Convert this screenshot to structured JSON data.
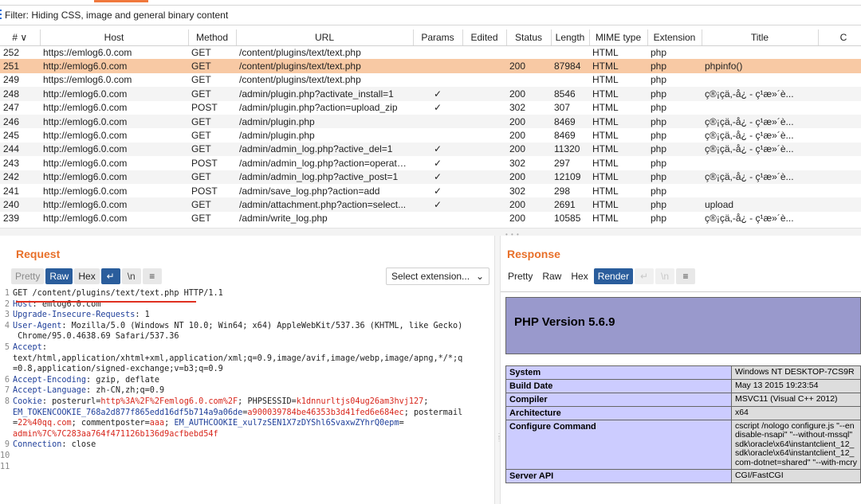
{
  "filter": {
    "text": "Filter: Hiding CSS, image and general binary content"
  },
  "table": {
    "headers": [
      "# ∨",
      "Host",
      "Method",
      "URL",
      "Params",
      "Edited",
      "Status",
      "Length",
      "MIME type",
      "Extension",
      "Title",
      "C"
    ],
    "rows": [
      {
        "num": "252",
        "host": "https://emlog6.0.com",
        "method": "GET",
        "url": "/content/plugins/text/text.php",
        "params": "",
        "edited": "",
        "status": "",
        "length": "",
        "mime": "HTML",
        "ext": "php",
        "title": ""
      },
      {
        "num": "251",
        "host": "http://emlog6.0.com",
        "method": "GET",
        "url": "/content/plugins/text/text.php",
        "params": "",
        "edited": "",
        "status": "200",
        "length": "87984",
        "mime": "HTML",
        "ext": "php",
        "title": "phpinfo()"
      },
      {
        "num": "249",
        "host": "https://emlog6.0.com",
        "method": "GET",
        "url": "/content/plugins/text/text.php",
        "params": "",
        "edited": "",
        "status": "",
        "length": "",
        "mime": "HTML",
        "ext": "php",
        "title": ""
      },
      {
        "num": "248",
        "host": "http://emlog6.0.com",
        "method": "GET",
        "url": "/admin/plugin.php?activate_install=1",
        "params": "✓",
        "edited": "",
        "status": "200",
        "length": "8546",
        "mime": "HTML",
        "ext": "php",
        "title": "ç®¡çä,-å¿ - ç¹æ»´è..."
      },
      {
        "num": "247",
        "host": "http://emlog6.0.com",
        "method": "POST",
        "url": "/admin/plugin.php?action=upload_zip",
        "params": "✓",
        "edited": "",
        "status": "302",
        "length": "307",
        "mime": "HTML",
        "ext": "php",
        "title": ""
      },
      {
        "num": "246",
        "host": "http://emlog6.0.com",
        "method": "GET",
        "url": "/admin/plugin.php",
        "params": "",
        "edited": "",
        "status": "200",
        "length": "8469",
        "mime": "HTML",
        "ext": "php",
        "title": "ç®¡çä,-å¿ - ç¹æ»´è..."
      },
      {
        "num": "245",
        "host": "http://emlog6.0.com",
        "method": "GET",
        "url": "/admin/plugin.php",
        "params": "",
        "edited": "",
        "status": "200",
        "length": "8469",
        "mime": "HTML",
        "ext": "php",
        "title": "ç®¡çä,-å¿ - ç¹æ»´è..."
      },
      {
        "num": "244",
        "host": "http://emlog6.0.com",
        "method": "GET",
        "url": "/admin/admin_log.php?active_del=1",
        "params": "✓",
        "edited": "",
        "status": "200",
        "length": "11320",
        "mime": "HTML",
        "ext": "php",
        "title": "ç®¡çä,-å¿ - ç¹æ»´è..."
      },
      {
        "num": "243",
        "host": "http://emlog6.0.com",
        "method": "POST",
        "url": "/admin/admin_log.php?action=operate...",
        "params": "✓",
        "edited": "",
        "status": "302",
        "length": "297",
        "mime": "HTML",
        "ext": "php",
        "title": ""
      },
      {
        "num": "242",
        "host": "http://emlog6.0.com",
        "method": "GET",
        "url": "/admin/admin_log.php?active_post=1",
        "params": "✓",
        "edited": "",
        "status": "200",
        "length": "12109",
        "mime": "HTML",
        "ext": "php",
        "title": "ç®¡çä,-å¿ - ç¹æ»´è..."
      },
      {
        "num": "241",
        "host": "http://emlog6.0.com",
        "method": "POST",
        "url": "/admin/save_log.php?action=add",
        "params": "✓",
        "edited": "",
        "status": "302",
        "length": "298",
        "mime": "HTML",
        "ext": "php",
        "title": ""
      },
      {
        "num": "240",
        "host": "http://emlog6.0.com",
        "method": "GET",
        "url": "/admin/attachment.php?action=select...",
        "params": "✓",
        "edited": "",
        "status": "200",
        "length": "2691",
        "mime": "HTML",
        "ext": "php",
        "title": "upload"
      },
      {
        "num": "239",
        "host": "http://emlog6.0.com",
        "method": "GET",
        "url": "/admin/write_log.php",
        "params": "",
        "edited": "",
        "status": "200",
        "length": "10585",
        "mime": "HTML",
        "ext": "php",
        "title": "ç®¡çä,-å¿ - ç¹æ»´è..."
      }
    ]
  },
  "request": {
    "title": "Request",
    "tabs": {
      "pretty": "Pretty",
      "raw": "Raw",
      "hex": "Hex"
    },
    "icons": {
      "wrap": "↵",
      "newline": "\\n",
      "menu": "≡"
    },
    "select_extension": "Select extension...",
    "lines": [
      {
        "n": "1",
        "parts": [
          {
            "t": "GET /content/plugins/text/text.php HTTP/1.1",
            "c": ""
          }
        ]
      },
      {
        "n": "2",
        "parts": [
          {
            "t": "Host",
            "c": "hn"
          },
          {
            "t": ": emlog6.0.com",
            "c": ""
          }
        ]
      },
      {
        "n": "3",
        "parts": [
          {
            "t": "Upgrade-Insecure-Requests",
            "c": "hn"
          },
          {
            "t": ": 1",
            "c": ""
          }
        ]
      },
      {
        "n": "4",
        "parts": [
          {
            "t": "User-Agent",
            "c": "hn"
          },
          {
            "t": ": Mozilla/5.0 (Windows NT 10.0; Win64; x64) AppleWebKit/537.36 (KHTML, like Gecko)",
            "c": ""
          }
        ]
      },
      {
        "n": "",
        "parts": [
          {
            "t": " Chrome/95.0.4638.69 Safari/537.36",
            "c": ""
          }
        ]
      },
      {
        "n": "5",
        "parts": [
          {
            "t": "Accept",
            "c": "hn"
          },
          {
            "t": ":",
            "c": ""
          }
        ]
      },
      {
        "n": "",
        "parts": [
          {
            "t": "text/html,application/xhtml+xml,application/xml;q=0.9,image/avif,image/webp,image/apng,*/*;q",
            "c": ""
          }
        ]
      },
      {
        "n": "",
        "parts": [
          {
            "t": "=0.8,application/signed-exchange;v=b3;q=0.9",
            "c": ""
          }
        ]
      },
      {
        "n": "6",
        "parts": [
          {
            "t": "Accept-Encoding",
            "c": "hn"
          },
          {
            "t": ": gzip, deflate",
            "c": ""
          }
        ]
      },
      {
        "n": "7",
        "parts": [
          {
            "t": "Accept-Language",
            "c": "hn"
          },
          {
            "t": ": zh-CN,zh;q=0.9",
            "c": ""
          }
        ]
      },
      {
        "n": "8",
        "parts": [
          {
            "t": "Cookie",
            "c": "hn"
          },
          {
            "t": ": posterurl=",
            "c": ""
          },
          {
            "t": "http%3A%2F%2Femlog6.0.com%2F",
            "c": "ck"
          },
          {
            "t": "; PHPSESSID=",
            "c": ""
          },
          {
            "t": "k1dnnurltjs04ug26am3hvj127",
            "c": "ck"
          },
          {
            "t": ";",
            "c": ""
          }
        ]
      },
      {
        "n": "",
        "parts": [
          {
            "t": "EM_TOKENCOOKIE_768a2d877f865edd16df5b714a9a06de",
            "c": "hn"
          },
          {
            "t": "=",
            "c": ""
          },
          {
            "t": "a900039784be46353b3d41fed6e684ec",
            "c": "ck"
          },
          {
            "t": "; postermail",
            "c": ""
          }
        ]
      },
      {
        "n": "",
        "parts": [
          {
            "t": "=",
            "c": ""
          },
          {
            "t": "22%40qq.com",
            "c": "ck"
          },
          {
            "t": "; commentposter=",
            "c": ""
          },
          {
            "t": "aaa",
            "c": "ck"
          },
          {
            "t": "; ",
            "c": ""
          },
          {
            "t": "EM_AUTHCOOKIE_xul7zSEN1X7zDYShl6SvaxwZYhrQ0epm",
            "c": "hn"
          },
          {
            "t": "=",
            "c": ""
          }
        ]
      },
      {
        "n": "",
        "parts": [
          {
            "t": "admin%7C%7C283aa764f471126b136d9acfbebd54f",
            "c": "ck"
          }
        ]
      },
      {
        "n": "9",
        "parts": [
          {
            "t": "Connection",
            "c": "hn"
          },
          {
            "t": ": close",
            "c": ""
          }
        ]
      },
      {
        "n": "10",
        "parts": [
          {
            "t": "",
            "c": ""
          }
        ]
      },
      {
        "n": "11",
        "parts": [
          {
            "t": "",
            "c": ""
          }
        ]
      }
    ]
  },
  "response": {
    "title": "Response",
    "tabs": {
      "pretty": "Pretty",
      "raw": "Raw",
      "hex": "Hex",
      "render": "Render"
    },
    "php_version": "PHP Version 5.6.9",
    "info_rows": [
      {
        "k": "System",
        "v": "Windows NT DESKTOP-7CS9R"
      },
      {
        "k": "Build Date",
        "v": "May 13 2015 19:23:54"
      },
      {
        "k": "Compiler",
        "v": "MSVC11 (Visual C++ 2012)"
      },
      {
        "k": "Architecture",
        "v": "x64"
      },
      {
        "k": "Configure Command",
        "v": "cscript /nologo configure.js \"--en\ndisable-nsapi\" \"--without-mssql\"\nsdk\\oracle\\x64\\instantclient_12_\nsdk\\oracle\\x64\\instantclient_12_\ncom-dotnet=shared\" \"--with-mcry"
      },
      {
        "k": "Server API",
        "v": "CGI/FastCGI"
      }
    ]
  },
  "colors": {
    "accent": "#e8702a",
    "selected_row": "#f8c9a4",
    "active_tab": "#2a5d9c",
    "php_header": "#9999cc"
  }
}
